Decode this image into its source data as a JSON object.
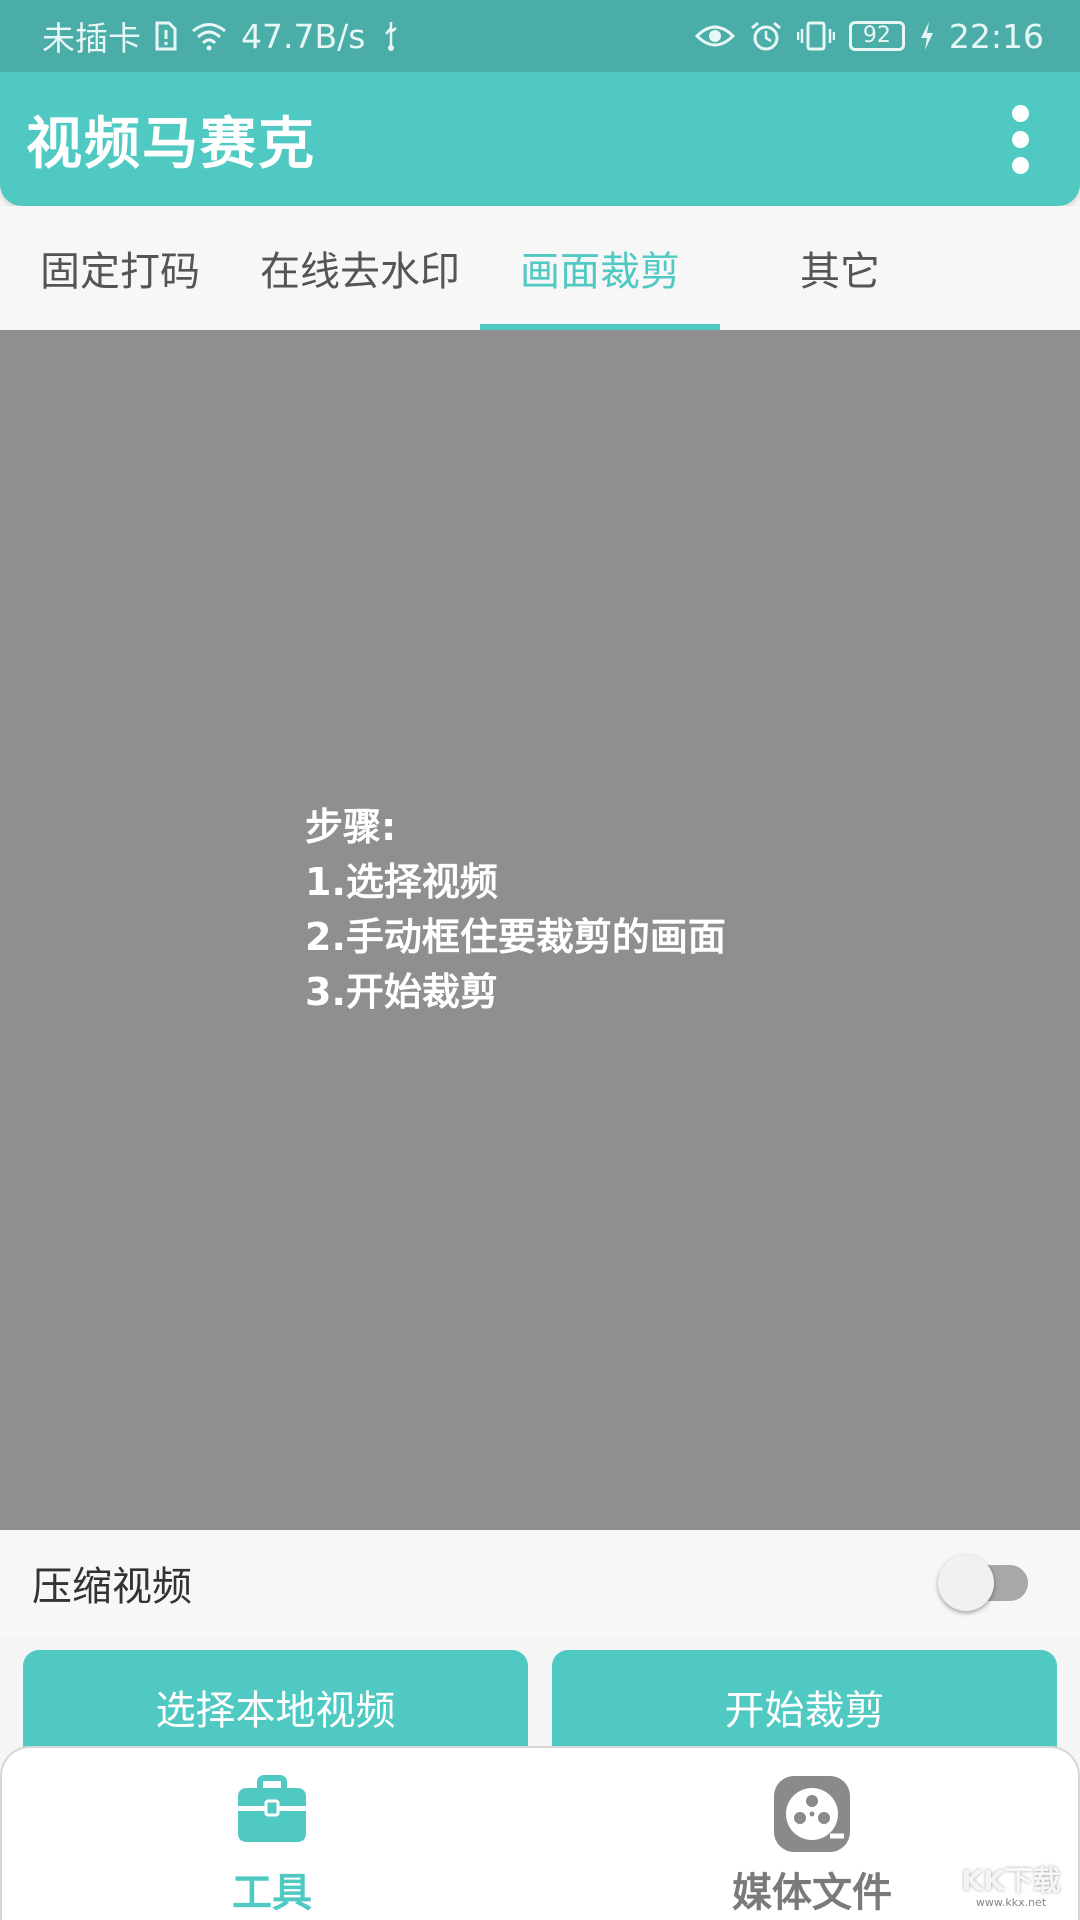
{
  "status_bar": {
    "carrier": "未插卡",
    "net_speed": "47.7B/s",
    "battery": "92",
    "time": "22:16",
    "icons": [
      "sim-alert-icon",
      "wifi-icon",
      "usb-icon",
      "eye-icon",
      "alarm-icon",
      "vibrate-icon",
      "battery-icon",
      "charging-icon"
    ]
  },
  "app_bar": {
    "title": "视频马赛克",
    "menu_icon": "more-vertical-icon"
  },
  "tabs": [
    {
      "label": "固定打码",
      "active": false
    },
    {
      "label": "在线去水印",
      "active": false
    },
    {
      "label": "画面裁剪",
      "active": true
    },
    {
      "label": "其它",
      "active": false
    }
  ],
  "preview": {
    "steps": [
      "步骤:",
      "1.选择视频",
      "2.手动框住要裁剪的画面",
      "3.开始裁剪"
    ]
  },
  "compress": {
    "label": "压缩视频",
    "enabled": false
  },
  "actions": {
    "select_video": "选择本地视频",
    "start_crop": "开始裁剪"
  },
  "bottom_nav": [
    {
      "label": "工具",
      "icon": "toolbox-icon",
      "active": true
    },
    {
      "label": "媒体文件",
      "icon": "film-reel-icon",
      "active": false
    }
  ],
  "watermark": {
    "text": "KK下载",
    "url": "www.kkx.net"
  },
  "colors": {
    "accent": "#51c9c3",
    "status_bar": "#4aada8",
    "preview_bg": "#8f8f8f"
  }
}
